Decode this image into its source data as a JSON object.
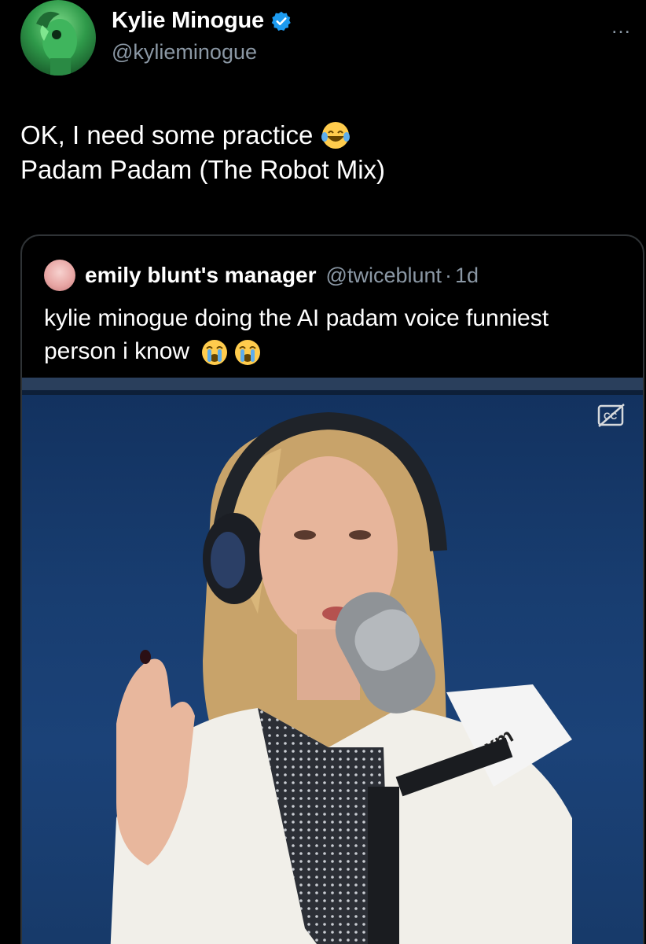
{
  "author": {
    "name": "Kylie Minogue",
    "handle": "@kylieminogue",
    "verified_color": "#1d9bf0"
  },
  "tweet": {
    "line1": "OK, I need some practice",
    "line1_emoji": "face-with-tears-of-joy",
    "line2": "Padam Padam (The Robot Mix)"
  },
  "quote": {
    "name": "emily blunt's manager",
    "handle": "@twiceblunt",
    "separator": "·",
    "time": "1d",
    "text": "kylie minogue doing the AI padam voice funniest person i know",
    "emojis": [
      "loudly-crying-face",
      "loudly-crying-face"
    ]
  },
  "media": {
    "cc_icon": "closed-captions-icon",
    "mic_flag_text": "sxm"
  },
  "more_icon": "…"
}
